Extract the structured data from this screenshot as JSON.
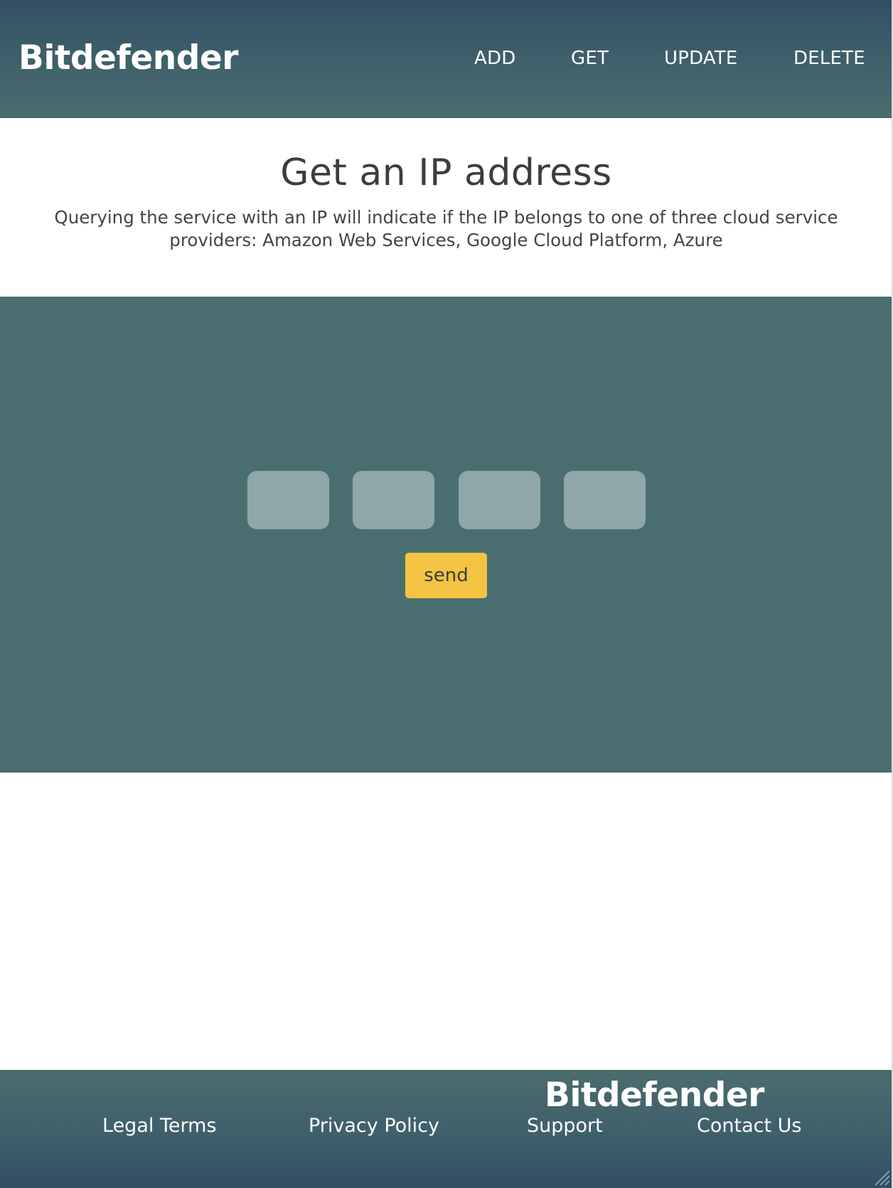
{
  "header": {
    "logo": "Bitdefender",
    "nav": {
      "add": "ADD",
      "get": "GET",
      "update": "UPDATE",
      "delete": "DELETE"
    }
  },
  "intro": {
    "title": "Get an IP address",
    "description": "Querying the service with an IP will indicate if the IP belongs to one of three cloud service providers: Amazon Web Services, Google Cloud Platform, Azure"
  },
  "form": {
    "octets": [
      "",
      "",
      "",
      ""
    ],
    "send_label": "send"
  },
  "footer": {
    "logo": "Bitdefender",
    "links": {
      "legal": "Legal Terms",
      "privacy": "Privacy Policy",
      "support": "Support",
      "contact": "Contact Us"
    }
  },
  "colors": {
    "header_gradient_top": "#324f63",
    "panel": "#4a6e6f",
    "input": "#8fa7a9",
    "send_button": "#f4c343"
  }
}
